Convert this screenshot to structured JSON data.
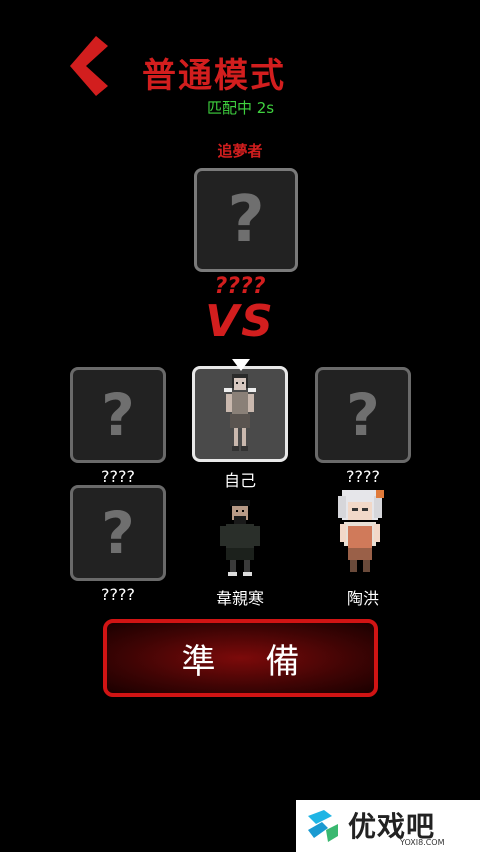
{
  "header": {
    "title": "普通模式",
    "status": "匹配中 2s"
  },
  "opponent": {
    "role": "追夢者",
    "slot_symbol": "?",
    "name": "????"
  },
  "vs_label": "VS",
  "players": [
    {
      "name": "????",
      "symbol": "?"
    },
    {
      "name": "自己"
    },
    {
      "name": "????",
      "symbol": "?"
    },
    {
      "name": "????",
      "symbol": "?"
    },
    {
      "name": "韋親寒"
    },
    {
      "name": "陶洪"
    }
  ],
  "ready_label": "準備",
  "watermark": {
    "text": "优戏吧",
    "url": "YOXI8.COM"
  },
  "colors": {
    "accent_red": "#d21e1e",
    "status_green": "#3fd13f",
    "slot_border": "#6a6a6a"
  }
}
